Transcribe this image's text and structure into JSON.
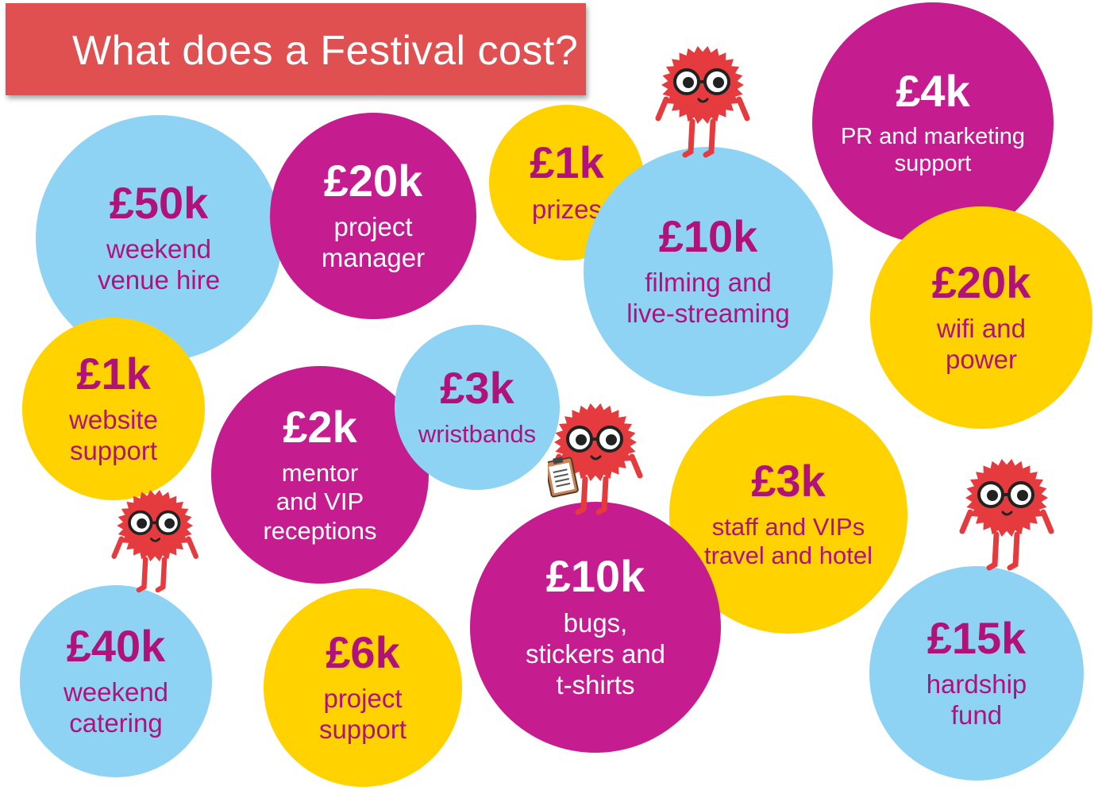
{
  "title": "What does a Festival cost?",
  "colors": {
    "banner": "#e05050",
    "blue": "#8fd3f4",
    "purple": "#c51c8f",
    "yellow": "#ffd200",
    "mascot": "#e53a3e"
  },
  "bubbles": [
    {
      "id": "venue-hire",
      "amount": "£50k",
      "lines": [
        "weekend",
        "venue hire"
      ]
    },
    {
      "id": "project-manager",
      "amount": "£20k",
      "lines": [
        "project",
        "manager"
      ]
    },
    {
      "id": "prizes",
      "amount": "£1k",
      "lines": [
        "prizes"
      ]
    },
    {
      "id": "filming",
      "amount": "£10k",
      "lines": [
        "filming and",
        "live-streaming"
      ]
    },
    {
      "id": "pr-marketing",
      "amount": "£4k",
      "lines": [
        "PR and marketing",
        "support"
      ]
    },
    {
      "id": "wifi-power",
      "amount": "£20k",
      "lines": [
        "wifi and",
        "power"
      ]
    },
    {
      "id": "website",
      "amount": "£1k",
      "lines": [
        "website",
        "support"
      ]
    },
    {
      "id": "receptions",
      "amount": "£2k",
      "lines": [
        "mentor",
        "and VIP",
        "receptions"
      ]
    },
    {
      "id": "wristbands",
      "amount": "£3k",
      "lines": [
        "wristbands"
      ]
    },
    {
      "id": "travel-hotel",
      "amount": "£3k",
      "lines": [
        "staff and VIPs",
        "travel and hotel"
      ]
    },
    {
      "id": "catering",
      "amount": "£40k",
      "lines": [
        "weekend",
        "catering"
      ]
    },
    {
      "id": "project-support",
      "amount": "£6k",
      "lines": [
        "project",
        "support"
      ]
    },
    {
      "id": "merch",
      "amount": "£10k",
      "lines": [
        "bugs,",
        "stickers and",
        "t-shirts"
      ]
    },
    {
      "id": "hardship",
      "amount": "£15k",
      "lines": [
        "hardship",
        "fund"
      ]
    }
  ]
}
